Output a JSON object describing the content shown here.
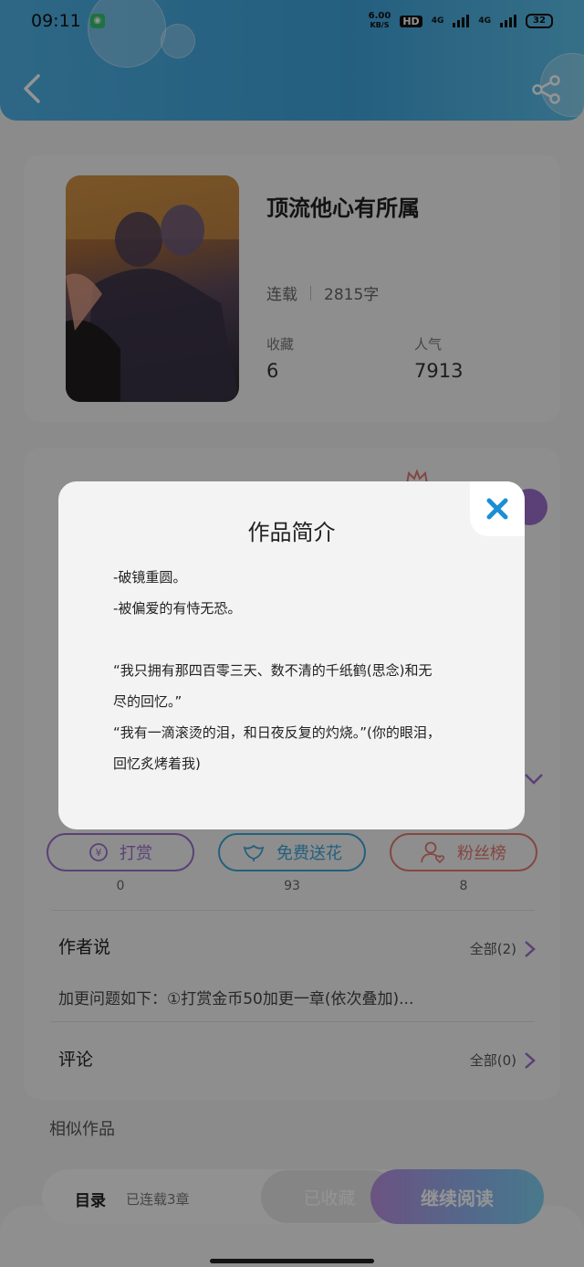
{
  "status": {
    "time": "09:11",
    "net_speed_value": "6.00",
    "net_speed_unit": "KB/S",
    "hd": "HD",
    "sig1": "4G",
    "sig2": "4G",
    "battery": "32"
  },
  "book": {
    "title": "顶流他心有所属",
    "status": "连载",
    "words": "2815字",
    "fav_label": "收藏",
    "fav_value": "6",
    "pop_label": "人气",
    "pop_value": "7913"
  },
  "actions": [
    {
      "label": "打赏",
      "count": "0",
      "color": "#9d6fce"
    },
    {
      "label": "免费送花",
      "count": "93",
      "color": "#3da6d8"
    },
    {
      "label": "粉丝榜",
      "count": "8",
      "color": "#e27a70"
    }
  ],
  "author_section": {
    "title": "作者说",
    "all": "全部(2)",
    "note": "加更问题如下：①打赏金币50加更一章(依次叠加)..."
  },
  "comments_section": {
    "title": "评论",
    "all": "全部(0)"
  },
  "similar_title": "相似作品",
  "bottom": {
    "toc": "目录",
    "toc_sub": "已连载3章",
    "saved": "已收藏",
    "continue": "继续阅读"
  },
  "modal": {
    "title": "作品简介",
    "lines": [
      "-破镜重圆。",
      "-被偏爱的有恃无恐。",
      "",
      "“我只拥有那四百零三天、数不清的千纸鹤(思念)和无",
      "尽的回忆。”",
      "“我有一滴滚烫的泪，和日夜反复的灼烧。”(你的眼泪，",
      "回忆炙烤着我)"
    ]
  },
  "colors": {
    "header": "#44aee2",
    "close_icon": "#1a8fd6",
    "action_purple": "#9d6fce",
    "action_blue": "#3da6d8",
    "action_red": "#e27a70"
  }
}
